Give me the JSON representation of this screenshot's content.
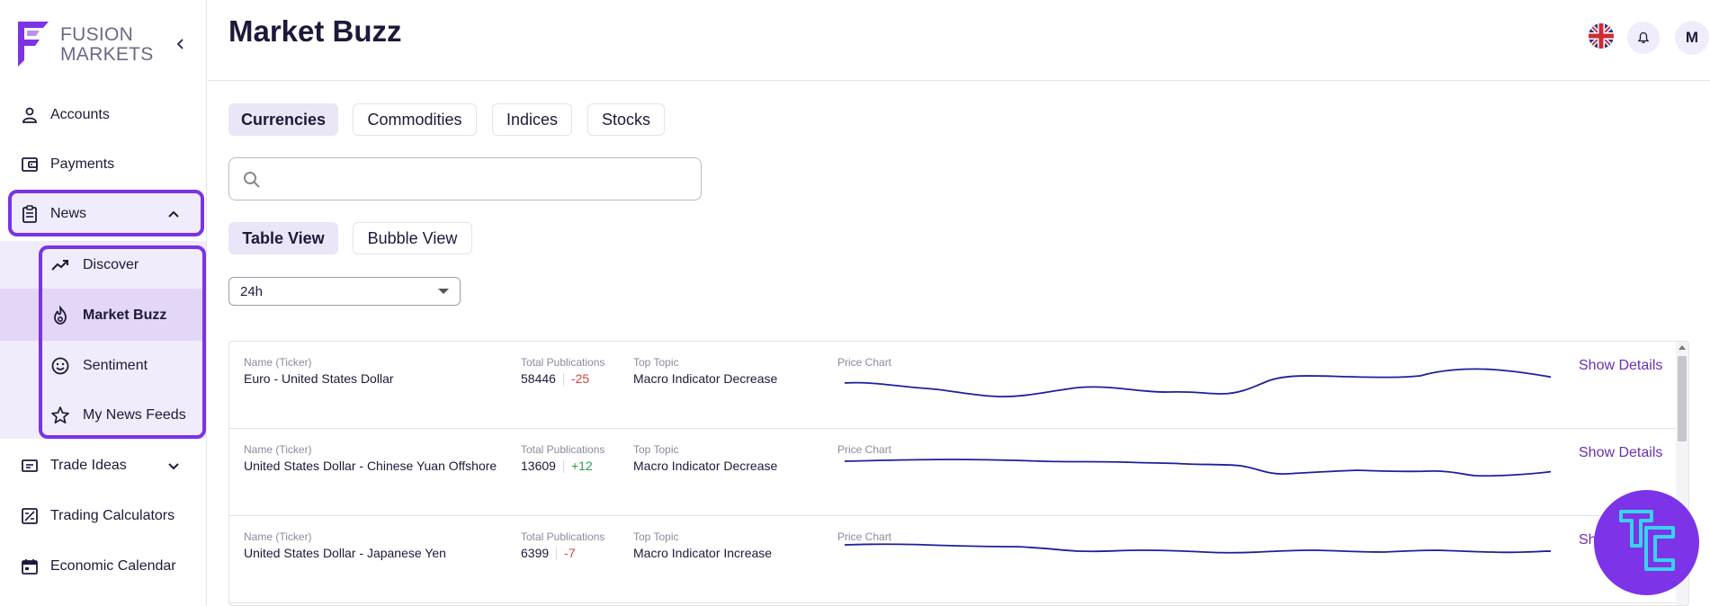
{
  "brand": {
    "line1": "FUSION",
    "line2": "MARKETS",
    "accent": "#7a33e6"
  },
  "sidebar": {
    "collapse_icon": "chevron-left-icon",
    "items": [
      {
        "label": "Accounts",
        "icon": "user-icon"
      },
      {
        "label": "Payments",
        "icon": "wallet-icon"
      },
      {
        "label": "News",
        "icon": "clipboard-icon"
      },
      {
        "label": "Trade Ideas",
        "icon": "lightbulb-icon"
      },
      {
        "label": "Trading Calculators",
        "icon": "calculator-icon"
      },
      {
        "label": "Economic Calendar",
        "icon": "calendar-icon"
      }
    ],
    "news_sub": [
      {
        "label": "Discover",
        "icon": "trending-up-icon"
      },
      {
        "label": "Market Buzz",
        "icon": "flame-icon",
        "active": true
      },
      {
        "label": "Sentiment",
        "icon": "smiley-icon"
      },
      {
        "label": "My News Feeds",
        "icon": "star-icon"
      }
    ]
  },
  "header": {
    "title": "Market Buzz",
    "avatar_initial": "M"
  },
  "tabs": [
    "Currencies",
    "Commodities",
    "Indices",
    "Stocks"
  ],
  "active_tab": "Currencies",
  "search": {
    "placeholder": ""
  },
  "views": [
    "Table View",
    "Bubble View"
  ],
  "active_view": "Table View",
  "period": {
    "selected": "24h"
  },
  "table": {
    "captions": {
      "name": "Name (Ticker)",
      "publications": "Total Publications",
      "topic": "Top Topic",
      "chart": "Price Chart"
    },
    "details_label": "Show Details",
    "details_cut_label": "Sh",
    "rows": [
      {
        "name": "Euro - United States Dollar",
        "publications": "58446",
        "change": "-25",
        "topic": "Macro Indicator Decrease"
      },
      {
        "name": "United States Dollar - Chinese Yuan Offshore",
        "publications": "13609",
        "change": "+12",
        "topic": "Macro Indicator Decrease"
      },
      {
        "name": "United States Dollar - Japanese Yen",
        "publications": "6399",
        "change": "-7",
        "topic": "Macro Indicator Increase"
      }
    ]
  },
  "colors": {
    "line": "#1f1f9a",
    "negative": "#d0453b",
    "positive": "#2f9c4a",
    "link": "#6b2fb0"
  }
}
